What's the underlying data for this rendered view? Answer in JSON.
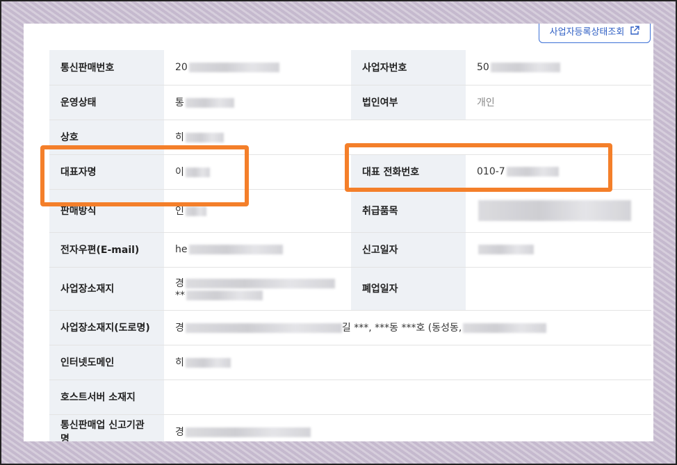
{
  "header": {
    "status_button_label": "사업자등록상태조회"
  },
  "rows": [
    {
      "label": "통신판매번호",
      "value": "20",
      "label2": "사업자번호",
      "value2": "50"
    },
    {
      "label": "운영상태",
      "value": "통",
      "label2": "법인여부",
      "value2": "개인"
    },
    {
      "label": "상호",
      "value": "히"
    },
    {
      "label": "대표자명",
      "value": "이",
      "label2": "대표 전화번호",
      "value2": "010-7"
    },
    {
      "label": "판매방식",
      "value": "인",
      "label2": "취급품목",
      "value2": ""
    },
    {
      "label": "전자우편(E-mail)",
      "value": "he",
      "label2": "신고일자",
      "value2": ""
    },
    {
      "label": "사업장소재지",
      "value": "경",
      "value_line2": "**",
      "label2": "폐업일자",
      "value2": ""
    },
    {
      "label": "사업장소재지(도로명)",
      "value": "경",
      "value_suffix": "길 ***, ***동 ***호 (동성동,"
    },
    {
      "label": "인터넷도메인",
      "value": "히"
    },
    {
      "label": "호스트서버 소재지",
      "value": ""
    },
    {
      "label": "통신판매업 신고기관명",
      "value": "경"
    }
  ],
  "highlight_color": "#f47f2a"
}
